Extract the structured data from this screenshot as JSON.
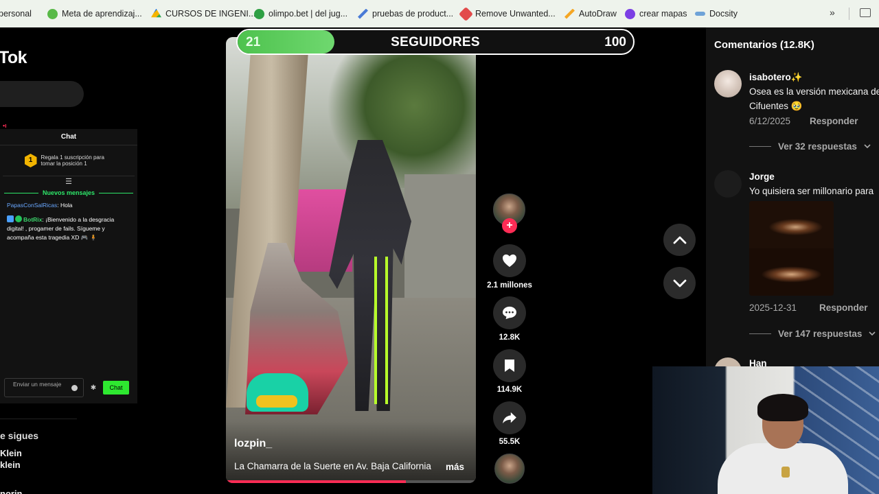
{
  "bookmarks": [
    {
      "label": "personal",
      "color": "#8a8a8a"
    },
    {
      "label": "Meta de aprendizaj...",
      "color": "#58b947"
    },
    {
      "label": "CURSOS DE INGENI...",
      "color": "#f5b400"
    },
    {
      "label": "olimpo.bet | del jug...",
      "color": "#2ea043"
    },
    {
      "label": "pruebas de product...",
      "color": "#4a7bd6"
    },
    {
      "label": "Remove Unwanted...",
      "color": "#e24b4b"
    },
    {
      "label": "AutoDraw",
      "color": "#f5a623"
    },
    {
      "label": "crear mapas",
      "color": "#7b3fe4"
    },
    {
      "label": "Docsity",
      "color": "#6fa3d8"
    }
  ],
  "left": {
    "logo": "Tok",
    "chat_title": "Chat",
    "rank_badge": "1",
    "rank_text": "Regala 1 suscripción para tomar la posición 1",
    "new_messages": "Nuevos mensajes",
    "messages": [
      {
        "user": "PapasConSalRicas",
        "text": ": Hola"
      },
      {
        "user": "BotRix",
        "text": ": ¡Bienvenido a la desgracia digital! , progamer de fails. Sígueme y acompaña esta tragedia XD 🎮 🧍"
      }
    ],
    "input_placeholder": "Enviar un mensaje",
    "send_label": "Chat",
    "following_title": "e sigues",
    "following": [
      "Klein",
      "klein",
      "norin"
    ]
  },
  "goal": {
    "current": "21",
    "label": "SEGUIDORES",
    "target": "100",
    "progress": 0.21
  },
  "video": {
    "author": "lozpin_",
    "description": "La Chamarra de la Suerte en Av. Baja California",
    "more": "más",
    "progress": 0.72
  },
  "actions": {
    "likes": "2.1 millones",
    "comments": "12.8K",
    "saves": "114.9K",
    "shares": "55.5K"
  },
  "comments": {
    "title": "Comentarios (12.8K)",
    "items": [
      {
        "user": "isabotero✨",
        "lines": [
          "Osea es la versión mexicana de",
          "Cifuentes 🥹"
        ],
        "date": "6/12/2025",
        "reply": "Responder",
        "replies": "Ver 32 respuestas"
      },
      {
        "user": "Jorge",
        "lines": [
          "Yo quisiera ser millonario para"
        ],
        "date": "2025-12-31",
        "reply": "Responder",
        "replies": "Ver 147 respuestas"
      },
      {
        "user": "Han"
      }
    ]
  },
  "colors": {
    "accent": "#fe2c55",
    "chat_green": "#2ee86a",
    "goal_green": "#4ec24e"
  }
}
